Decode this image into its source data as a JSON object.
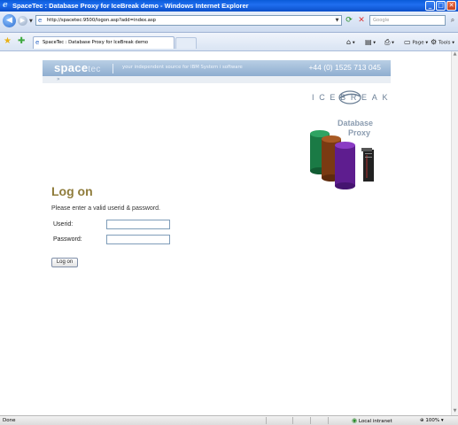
{
  "window": {
    "title": "SpaceTec : Database Proxy for IceBreak demo - Windows Internet Explorer",
    "buttons": {
      "minimize": "_",
      "maximize": "□",
      "close": "✕"
    }
  },
  "addressbar": {
    "url": "http://spacetec:9500/logon.asp?add=index.asp",
    "search_placeholder": "Google"
  },
  "tabs": [
    {
      "label": "SpaceTec : Database Proxy for IceBreak demo"
    }
  ],
  "commandbar": {
    "page_label": "Page",
    "tools_label": "Tools"
  },
  "banner": {
    "brand": "space",
    "brand_suffix": "tec",
    "tagline": "your independent source for IBM System i software",
    "phone": "+44 (0) 1525 713 045",
    "subnav": "»"
  },
  "logo": {
    "text": "ICEBREAK"
  },
  "product": {
    "line1": "Database",
    "line2": "Proxy"
  },
  "login": {
    "heading": "Log on",
    "instruction": "Please enter a valid userid & password.",
    "userid_label": "Userid:",
    "password_label": "Password:",
    "userid_value": "",
    "password_value": "",
    "submit_label": "Log on"
  },
  "statusbar": {
    "status": "Done",
    "zone": "Local intranet",
    "zoom": "100%"
  },
  "colors": {
    "heading": "#8f7c3b",
    "banner": "#a8c2de",
    "titlebar": "#0b4fc9"
  }
}
